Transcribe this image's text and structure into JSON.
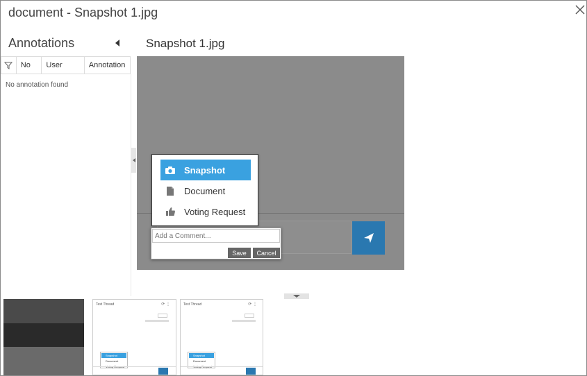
{
  "window": {
    "title": "document - Snapshot 1.jpg"
  },
  "annotations": {
    "title": "Annotations",
    "columns": [
      "No",
      "User",
      "Annotation"
    ],
    "empty_text": "No annotation found"
  },
  "viewer": {
    "title": "Snapshot 1.jpg"
  },
  "popup_menu": {
    "items": [
      {
        "label": "Snapshot",
        "icon": "camera-icon",
        "selected": true
      },
      {
        "label": "Document",
        "icon": "document-icon",
        "selected": false
      },
      {
        "label": "Voting Request",
        "icon": "thumbs-up-icon",
        "selected": false
      }
    ]
  },
  "comment": {
    "placeholder": "Add a Comment...",
    "save_label": "Save",
    "cancel_label": "Cancel"
  },
  "thumbnails": [
    {
      "header": ""
    },
    {
      "header": "Test Thread",
      "menu": [
        "Snapshot",
        "Document",
        "Voting Request"
      ]
    },
    {
      "header": "Test Thread",
      "menu": [
        "Snapshot",
        "Document",
        "Voting Request"
      ]
    }
  ],
  "colors": {
    "accent": "#3aa1e0",
    "send_button": "#2a78b0",
    "image_bg": "#8b8b8b"
  }
}
